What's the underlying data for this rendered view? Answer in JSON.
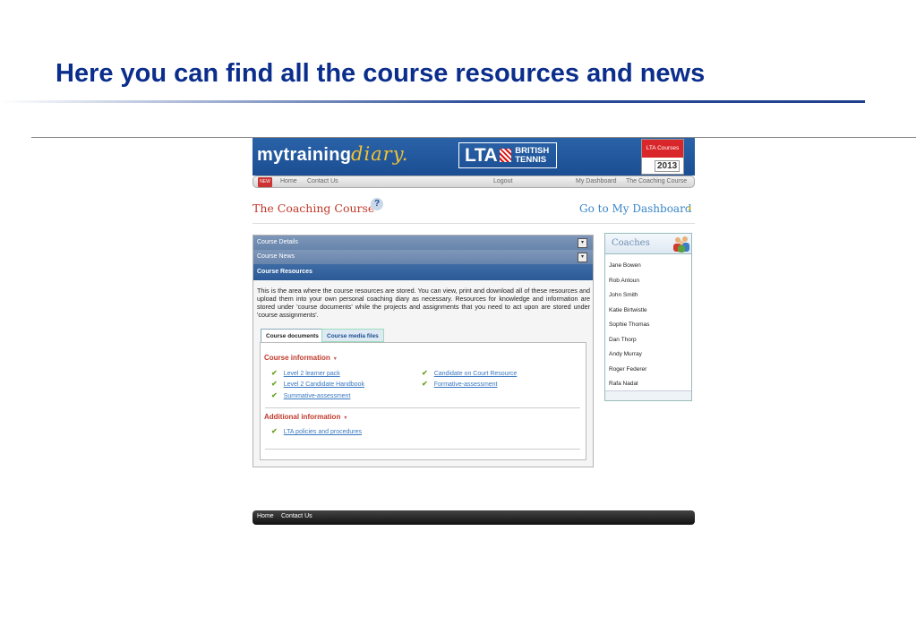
{
  "slide": {
    "title": "Here you can find all the course resources and news"
  },
  "brand": {
    "name": "mytraining",
    "script": "diary.",
    "lta_main": "LTA",
    "lta_sub_1": "BRITISH",
    "lta_sub_2": "TENNIS",
    "calendar_label": "LTA Courses",
    "calendar_year": "2013",
    "nav_logo": "NEW"
  },
  "nav": {
    "home": "Home",
    "contact": "Contact Us",
    "logout": "Logout",
    "dashboard": "My Dashboard",
    "coaching_course": "The Coaching Course"
  },
  "page": {
    "title": "The Coaching Course",
    "help": "?",
    "dashboard_link": "Go to My Dashboard",
    "dashboard_chevron": "›"
  },
  "accordion": {
    "details": "Course Details",
    "news": "Course News",
    "resources": "Course Resources",
    "toggle": "▾"
  },
  "resources": {
    "description": "This is the area where the course resources are stored. You can view, print and download all of these resources and upload them into your own personal coaching diary as necessary. Resources for knowledge and information are stored under 'course documents' while the projects and assignments that you need to act upon are stored under 'course assignments'.",
    "tabs": [
      "Course documents",
      "Course media files"
    ],
    "sections": [
      {
        "title": "Course information",
        "caret": "▾",
        "items_left": [
          "Level 2 learner pack",
          "Level 2 Candidate Handbook",
          "Summative-assessment"
        ],
        "items_right": [
          "Candidate on Court Resource",
          "Formative-assessment"
        ]
      },
      {
        "title": "Additional information",
        "caret": "▾",
        "items_left": [
          "LTA policies and procedures"
        ],
        "items_right": []
      }
    ],
    "check": "✔"
  },
  "coaches": {
    "title": "Coaches",
    "names": [
      "Jane Bowen",
      "Rob Antoun",
      "John Smith",
      "Katie Birtwistle",
      "Sophie Thomas",
      "Dan Thorp",
      "Andy Murray",
      "Roger Federer",
      "Rafa Nadal"
    ]
  },
  "footer": {
    "home": "Home",
    "contact": "Contact Us"
  }
}
